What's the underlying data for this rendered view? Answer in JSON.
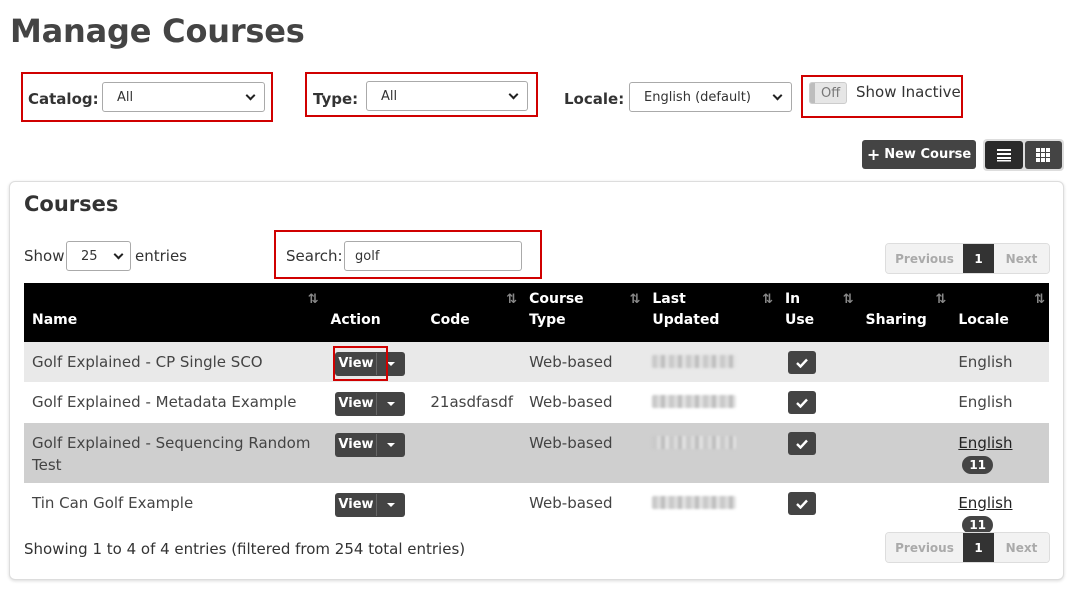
{
  "page": {
    "title": "Manage Courses"
  },
  "filters": {
    "catalog": {
      "label": "Catalog:",
      "value": "All"
    },
    "type": {
      "label": "Type:",
      "value": "All"
    },
    "locale": {
      "label": "Locale:",
      "value": "English (default)"
    },
    "show_inactive": {
      "toggle_text": "Off",
      "label": "Show Inactive"
    }
  },
  "toolbar": {
    "new_course_label": "New Course"
  },
  "panel": {
    "title": "Courses",
    "show_label": "Show",
    "entries_label": "entries",
    "entries_value": "25",
    "search_label": "Search:",
    "search_value": "golf"
  },
  "pagination": {
    "previous": "Previous",
    "current": "1",
    "next": "Next"
  },
  "table": {
    "columns": [
      "Name",
      "Action",
      "Code",
      "Course Type",
      "Last Updated",
      "In Use",
      "Sharing",
      "Locale"
    ],
    "column_lines": {
      "course_type": [
        "Course",
        "Type"
      ],
      "last_updated": [
        "Last",
        "Updated"
      ],
      "in_use": [
        "In",
        "Use"
      ]
    },
    "rows": [
      {
        "name": "Golf Explained - CP Single SCO",
        "action": "View",
        "code": "",
        "type": "Web-based",
        "locale": "English",
        "locale_count": ""
      },
      {
        "name": "Golf Explained - Metadata Example",
        "action": "View",
        "code": "21asdfasdf",
        "type": "Web-based",
        "locale": "English",
        "locale_count": ""
      },
      {
        "name": "Golf Explained - Sequencing Random Test",
        "action": "View",
        "code": "",
        "type": "Web-based",
        "locale": "English",
        "locale_count": "11"
      },
      {
        "name": "Tin Can Golf Example",
        "action": "View",
        "code": "",
        "type": "Web-based",
        "locale": "English",
        "locale_count": "11"
      }
    ]
  },
  "footer": {
    "info": "Showing 1 to 4 of 4 entries (filtered from 254 total entries)"
  },
  "colors": {
    "highlight": "#d00000",
    "dark_button": "#444444",
    "header_bg": "#000000"
  }
}
